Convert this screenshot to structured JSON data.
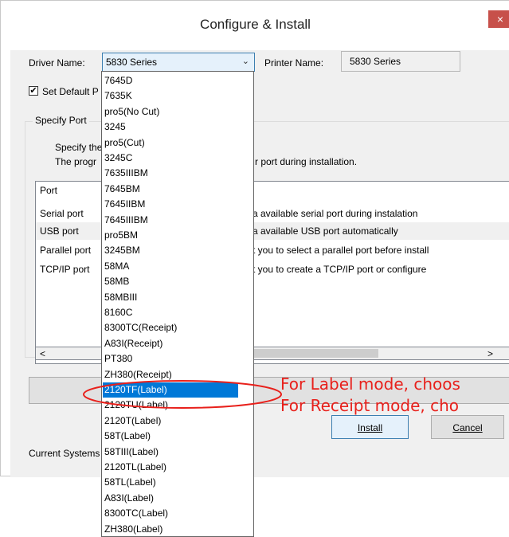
{
  "window": {
    "title": "Configure & Install",
    "close_glyph": "×"
  },
  "form": {
    "driver_name_label": "Driver Name:",
    "driver_value": "5830 Series",
    "printer_name_label": "Printer Name:",
    "printer_value": "5830 Series",
    "set_default_label": "Set Default P",
    "set_default_checked": true,
    "specify_port_label": "Specify Port",
    "specify_line1": "Specify the",
    "specify_line2": "The progr",
    "specify_line2_rest": "r port during installation.",
    "current_system_label": "Current Systems"
  },
  "port_table": {
    "header": "Port",
    "rows": [
      {
        "port": "Serial port",
        "desc": "a available serial port during instalation"
      },
      {
        "port": "USB port",
        "desc": "a available USB port automatically"
      },
      {
        "port": "Parallel port",
        "desc": "t you to select a parallel port before install"
      },
      {
        "port": "TCP/IP port",
        "desc": "t you to create a TCP/IP port or configure"
      }
    ]
  },
  "buttons": {
    "install": "Install",
    "cancel": "Cancel"
  },
  "dropdown": {
    "items": [
      "7645D",
      "7635K",
      "pro5(No Cut)",
      "3245",
      "pro5(Cut)",
      "3245C",
      "7635IIIBM",
      "7645BM",
      "7645IIBM",
      "7645IIIBM",
      "pro5BM",
      "3245BM",
      "58MA",
      "58MB",
      "58MBIII",
      "8160C",
      "8300TC(Receipt)",
      "A83I(Receipt)",
      "PT380",
      "ZH380(Receipt)",
      "2120TF(Label)",
      "2120TU(Label)",
      "2120T(Label)",
      "58T(Label)",
      "58TIII(Label)",
      "2120TL(Label)",
      "58TL(Label)",
      "A83I(Label)",
      "8300TC(Label)",
      "ZH380(Label)"
    ],
    "selected_index": 20
  },
  "annotations": {
    "line1": "For Label mode, choos",
    "line2": "For Receipt mode, cho"
  },
  "colors": {
    "accent": "#0078d7",
    "annotation": "#e8201b",
    "close": "#c7504a"
  }
}
